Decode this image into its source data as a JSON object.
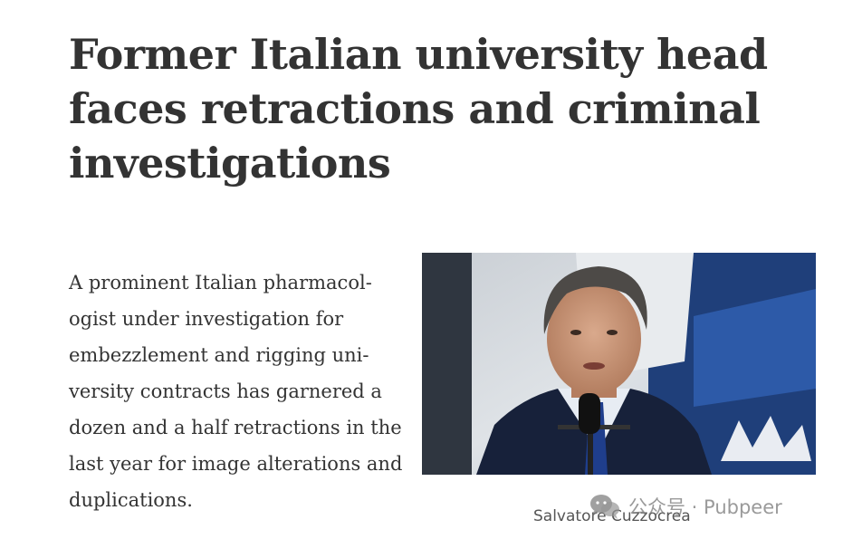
{
  "article": {
    "headline": "Former Italian university head faces retractions and criminal investigations",
    "lede": "A prominent Italian pharmacol­ogist under investigation for embezzlement and rigging uni­versity contracts has garnered a dozen and a half retractions in the last year for image alter­ations and duplications.",
    "photo_caption": "Salvatore Cuzzocrea"
  },
  "watermark": {
    "icon": "wechat-icon",
    "text": "公众号 · Pubpeer"
  }
}
